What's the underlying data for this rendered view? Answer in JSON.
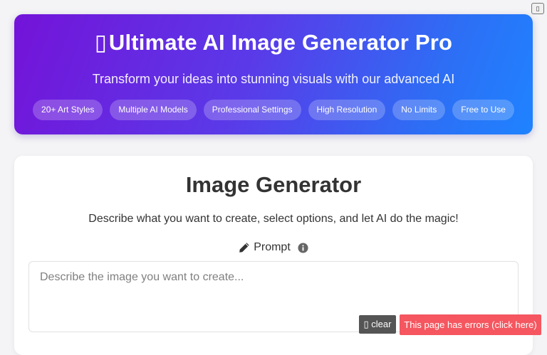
{
  "corner_button": {
    "glyph": "▯"
  },
  "hero": {
    "title_glyph": "▯",
    "title": "Ultimate AI Image Generator Pro",
    "subtitle": "Transform your ideas into stunning visuals with our advanced AI",
    "chips": [
      "20+ Art Styles",
      "Multiple AI Models",
      "Professional Settings",
      "High Resolution",
      "No Limits",
      "Free to Use"
    ]
  },
  "generator": {
    "title": "Image Generator",
    "description": "Describe what you want to create, select options, and let AI do the magic!",
    "prompt_label": "Prompt",
    "prompt_placeholder": "Describe the image you want to create...",
    "prompt_value": ""
  },
  "debug": {
    "clear_glyph": "▯",
    "clear_label": "clear",
    "errors_label": "This page has errors (click here)"
  },
  "colors": {
    "hero_gradient_start": "#7413d9",
    "hero_gradient_end": "#1f83ff",
    "error_red": "#f5565f",
    "clear_gray": "#555555"
  }
}
